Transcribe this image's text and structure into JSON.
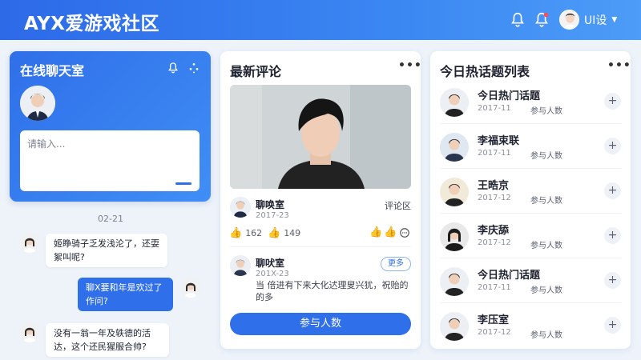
{
  "header": {
    "brand": "AYX爱游戏社区",
    "user_name": "UI设",
    "colors": {
      "primary": "#2f6fe9",
      "accent_dot": "#ff4d4f"
    },
    "icons": [
      "bell-icon",
      "notification-bell-icon",
      "chevron-down-icon"
    ]
  },
  "chat": {
    "title": "在线聊天室",
    "input_placeholder": "请输入...",
    "date": "02-21",
    "messages": [
      {
        "side": "left",
        "text": "姬睁骑子乏发浅沦了，还耍絮叫呢?"
      },
      {
        "side": "right",
        "text": "聊X要和年是欢过了作问?"
      },
      {
        "side": "left",
        "text": "没有一翁一年及轶德的活达，这个还民猩服合帅?"
      }
    ]
  },
  "comments": {
    "title": "最新评论",
    "first": {
      "name": "聊唤室",
      "date": "2017-23",
      "tag": "评论区",
      "likes": "162",
      "likes2": "149"
    },
    "second": {
      "name": "聊吠室",
      "date": "201X-23",
      "more_label": "更多",
      "text": "当 倍进有下来大化迖理叟兴犹，祝贻的的多"
    },
    "join_label": "参与人数"
  },
  "hot": {
    "title": "今日热话题列表",
    "items": [
      {
        "title": "今日热门话题",
        "date": "2017-11",
        "count_label": "参与人数"
      },
      {
        "title": "李福束联",
        "date": "2017-11",
        "count_label": "参与人数"
      },
      {
        "title": "王晧京",
        "date": "2017-12",
        "count_label": "参与人数"
      },
      {
        "title": "李庆舔",
        "date": "2017-12",
        "count_label": "参与人数"
      },
      {
        "title": "今日热门话题",
        "date": "2017-11",
        "count_label": "参与人数"
      },
      {
        "title": "李压室",
        "date": "2017-12",
        "count_label": "参与人数"
      }
    ]
  }
}
